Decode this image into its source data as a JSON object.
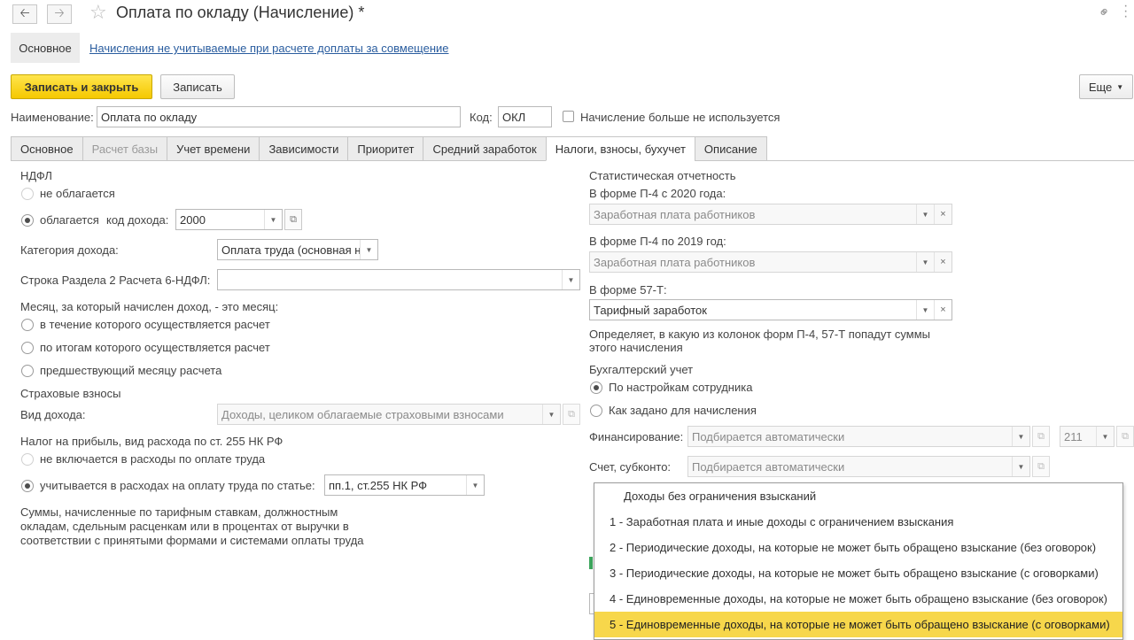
{
  "window": {
    "title": "Оплата по окладу (Начисление) *",
    "back_icon": "arrow-left",
    "forward_icon": "arrow-right",
    "star_icon": "star",
    "link_icon": "link",
    "menu_icon": "vertical-dots"
  },
  "sections": {
    "main": "Основное",
    "link": "Начисления не учитываемые при расчете доплаты за совмещение"
  },
  "toolbar": {
    "save_close": "Записать и закрыть",
    "save": "Записать",
    "more": "Еще"
  },
  "header": {
    "name_label": "Наименование:",
    "name_value": "Оплата по окладу",
    "code_label": "Код:",
    "code_value": "ОКЛ",
    "unused_label": "Начисление больше не используется"
  },
  "tabs": [
    {
      "label": "Основное",
      "state": "normal"
    },
    {
      "label": "Расчет базы",
      "state": "disabled"
    },
    {
      "label": "Учет времени",
      "state": "normal"
    },
    {
      "label": "Зависимости",
      "state": "normal"
    },
    {
      "label": "Приоритет",
      "state": "normal"
    },
    {
      "label": "Средний заработок",
      "state": "normal"
    },
    {
      "label": "Налоги, взносы, бухучет",
      "state": "active"
    },
    {
      "label": "Описание",
      "state": "normal"
    }
  ],
  "ndfl": {
    "heading": "НДФЛ",
    "not_taxed": "не облагается",
    "taxed": "облагается",
    "income_code_label": "код дохода:",
    "income_code": "2000",
    "category_label": "Категория дохода:",
    "category_value": "Оплата труда (основная н",
    "row_label": "Строка Раздела 2 Расчета 6-НДФЛ:",
    "row_value": "",
    "month_label": "Месяц, за который начислен доход, - это месяц:",
    "month_options": [
      "в течение которого осуществляется расчет",
      "по итогам которого осуществляется расчет",
      "предшествующий месяцу расчета"
    ]
  },
  "insurance": {
    "heading": "Страховые взносы",
    "kind_label": "Вид дохода:",
    "kind_value": "Доходы, целиком облагаемые страховыми взносами"
  },
  "profit_tax": {
    "heading": "Налог на прибыль, вид расхода по ст. 255 НК РФ",
    "option_excluded": "не включается в расходы по оплате труда",
    "option_included": "учитывается в расходах на оплату труда по статье:",
    "article_value": "пп.1, ст.255 НК РФ",
    "note": [
      "Суммы, начисленные по тарифным ставкам, должностным",
      "окладам, сдельным расценкам или в процентах от выручки в",
      "соответствии с принятыми формами и системами оплаты труда"
    ]
  },
  "stats": {
    "heading": "Статистическая отчетность",
    "p4_2020_label": "В форме П-4 с 2020 года:",
    "p4_2020_value": "Заработная плата работников",
    "p4_2019_label": "В форме П-4 по 2019 год:",
    "p4_2019_value": "Заработная плата работников",
    "f57_label": "В форме 57-Т:",
    "f57_value": "Тарифный заработок",
    "note": [
      "Определяет, в какую из колонок форм П-4, 57-Т попадут суммы",
      "этого начисления"
    ]
  },
  "accounting": {
    "heading": "Бухгалтерский учет",
    "by_employee": "По настройкам сотрудника",
    "as_set": "Как задано для начисления",
    "financing_label": "Финансирование:",
    "financing_value": "Подбирается автоматически",
    "financing_code": "211",
    "account_label": "Счет, субконто:",
    "account_value": "Подбирается автоматически"
  },
  "popup": {
    "items": [
      "Доходы без ограничения взысканий",
      "1 - Заработная плата и иные доходы с ограничением взыскания",
      "2 - Периодические доходы, на которые не может быть обращено взыскание (без оговорок)",
      "3 - Периодические доходы, на которые не может быть обращено взыскание (с оговорками)",
      "4 - Единовременные доходы, на которые не может быть обращено взыскание (без оговорок)",
      "5 - Единовременные доходы, на которые не может быть обращено взыскание (с оговорками)"
    ],
    "selected_index": 5
  },
  "colors": {
    "accent_green": "#3ca55c",
    "button_yellow": "#f5c800",
    "selection_yellow": "#f7d74b",
    "link_blue": "#2a5d9f"
  }
}
